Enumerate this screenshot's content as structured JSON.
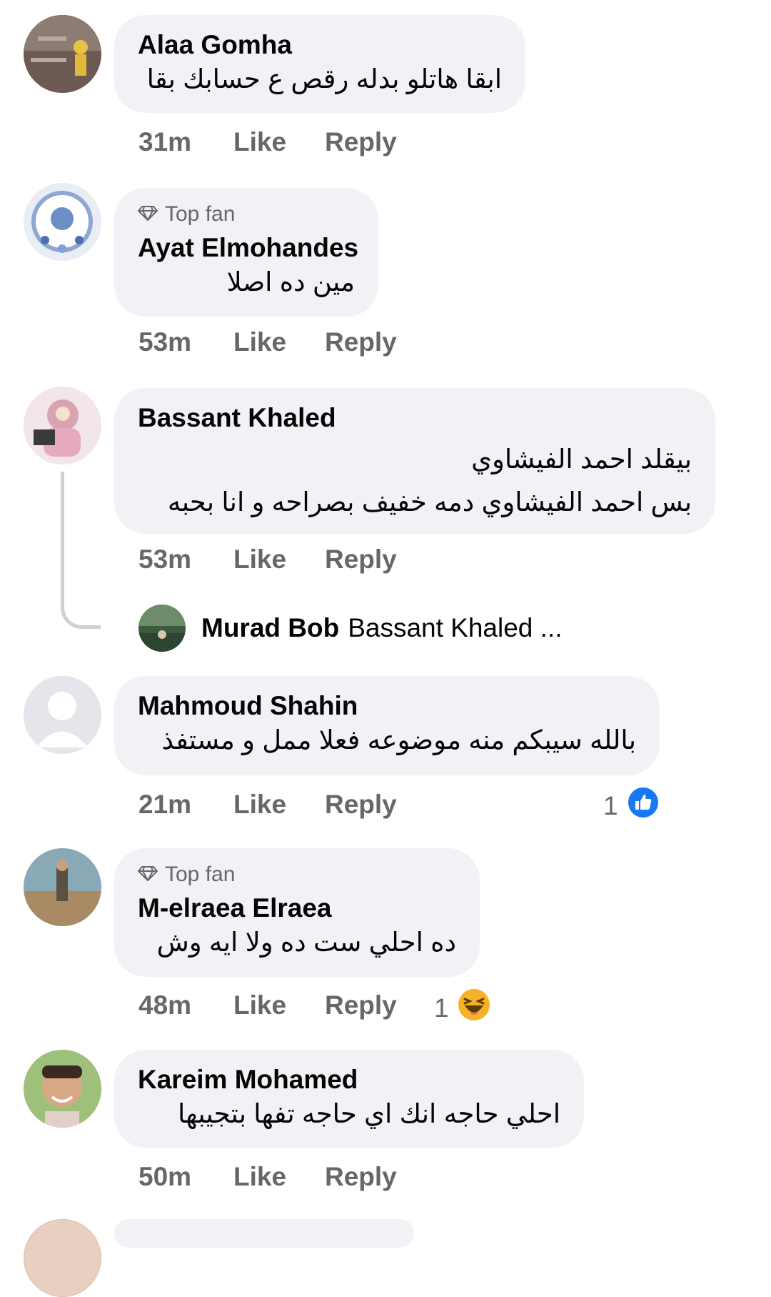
{
  "comments": [
    {
      "name": "Alaa Gomha",
      "text": "ابقا هاتلو بدله رقص ع حسابك بقا",
      "time": "31m"
    },
    {
      "name": "Ayat Elmohandes",
      "badge": "Top fan",
      "text": "مين ده اصلا",
      "time": "53m"
    },
    {
      "name": "Bassant Khaled",
      "text_line1": "بيقلد احمد الفيشاوي",
      "text_line2": "بس احمد الفيشاوي دمه خفيف بصراحه و انا بحبه",
      "time": "53m",
      "reply": {
        "name": "Murad Bob",
        "preview": "Bassant Khaled ..."
      }
    },
    {
      "name": "Mahmoud Shahin",
      "text": "بالله سيبكم منه موضوعه فعلا ممل و مستفذ",
      "time": "21m",
      "reaction_count": "1"
    },
    {
      "name": "M-elraea Elraea",
      "badge": "Top fan",
      "text": "ده احلي ست ده ولا ايه وش",
      "time": "48m",
      "reaction_count": "1"
    },
    {
      "name": "Kareim Mohamed",
      "text": "احلي حاجه انك اي حاجه تفها بتجيبها",
      "time": "50m"
    }
  ],
  "actions": {
    "like": "Like",
    "reply": "Reply"
  },
  "colors": {
    "bubble": "#f0f2f5",
    "meta": "#65676b",
    "like_blue": "#1877f2",
    "haha_yellow": "#f7b125"
  }
}
